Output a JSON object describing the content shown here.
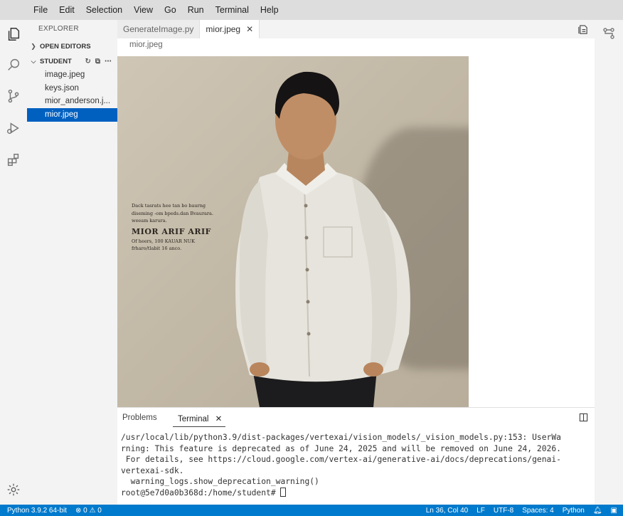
{
  "menu": [
    "File",
    "Edit",
    "Selection",
    "View",
    "Go",
    "Run",
    "Terminal",
    "Help"
  ],
  "sidebar": {
    "title": "EXPLORER",
    "open_editors": "OPEN EDITORS",
    "folder": "STUDENT",
    "files": [
      {
        "label": "image.jpeg"
      },
      {
        "label": "keys.json"
      },
      {
        "label": "mior_anderson.j..."
      },
      {
        "label": "mior.jpeg"
      }
    ]
  },
  "tabs": [
    {
      "label": "GenerateImage.py"
    },
    {
      "label": "mior.jpeg"
    }
  ],
  "breadcrumb": "mior.jpeg",
  "image_caption": {
    "line1": "Dack tasrats hee tan bo baurng",
    "line2": "diseming -om bpeds.dan Bvaurara.",
    "line3": "weeam karura.",
    "name": "MIOR ARIF ARIF",
    "line4": "Of heers, 100 KAUAR NUK",
    "line5": "frharo/tlabit 16 anco."
  },
  "panel": {
    "tabs": [
      "Problems",
      "Terminal"
    ],
    "terminal_lines": [
      "/usr/local/lib/python3.9/dist-packages/vertexai/vision_models/_vision_models.py:153: UserWa",
      "rning: This feature is deprecated as of June 24, 2025 and will be removed on June 24, 2026.",
      " For details, see https://cloud.google.com/vertex-ai/generative-ai/docs/deprecations/genai-",
      "vertexai-sdk.",
      "  warning_logs.show_deprecation_warning()",
      "root@5e7d0a0b368d:/home/student# "
    ]
  },
  "status": {
    "python": "Python 3.9.2 64-bit",
    "errors": "0",
    "warnings": "0",
    "position": "Ln 36, Col 40",
    "eol": "LF",
    "encoding": "UTF-8",
    "spaces": "Spaces: 4",
    "language": "Python"
  },
  "colors": {
    "status_bar": "#007acc",
    "selection": "#0060c0"
  }
}
